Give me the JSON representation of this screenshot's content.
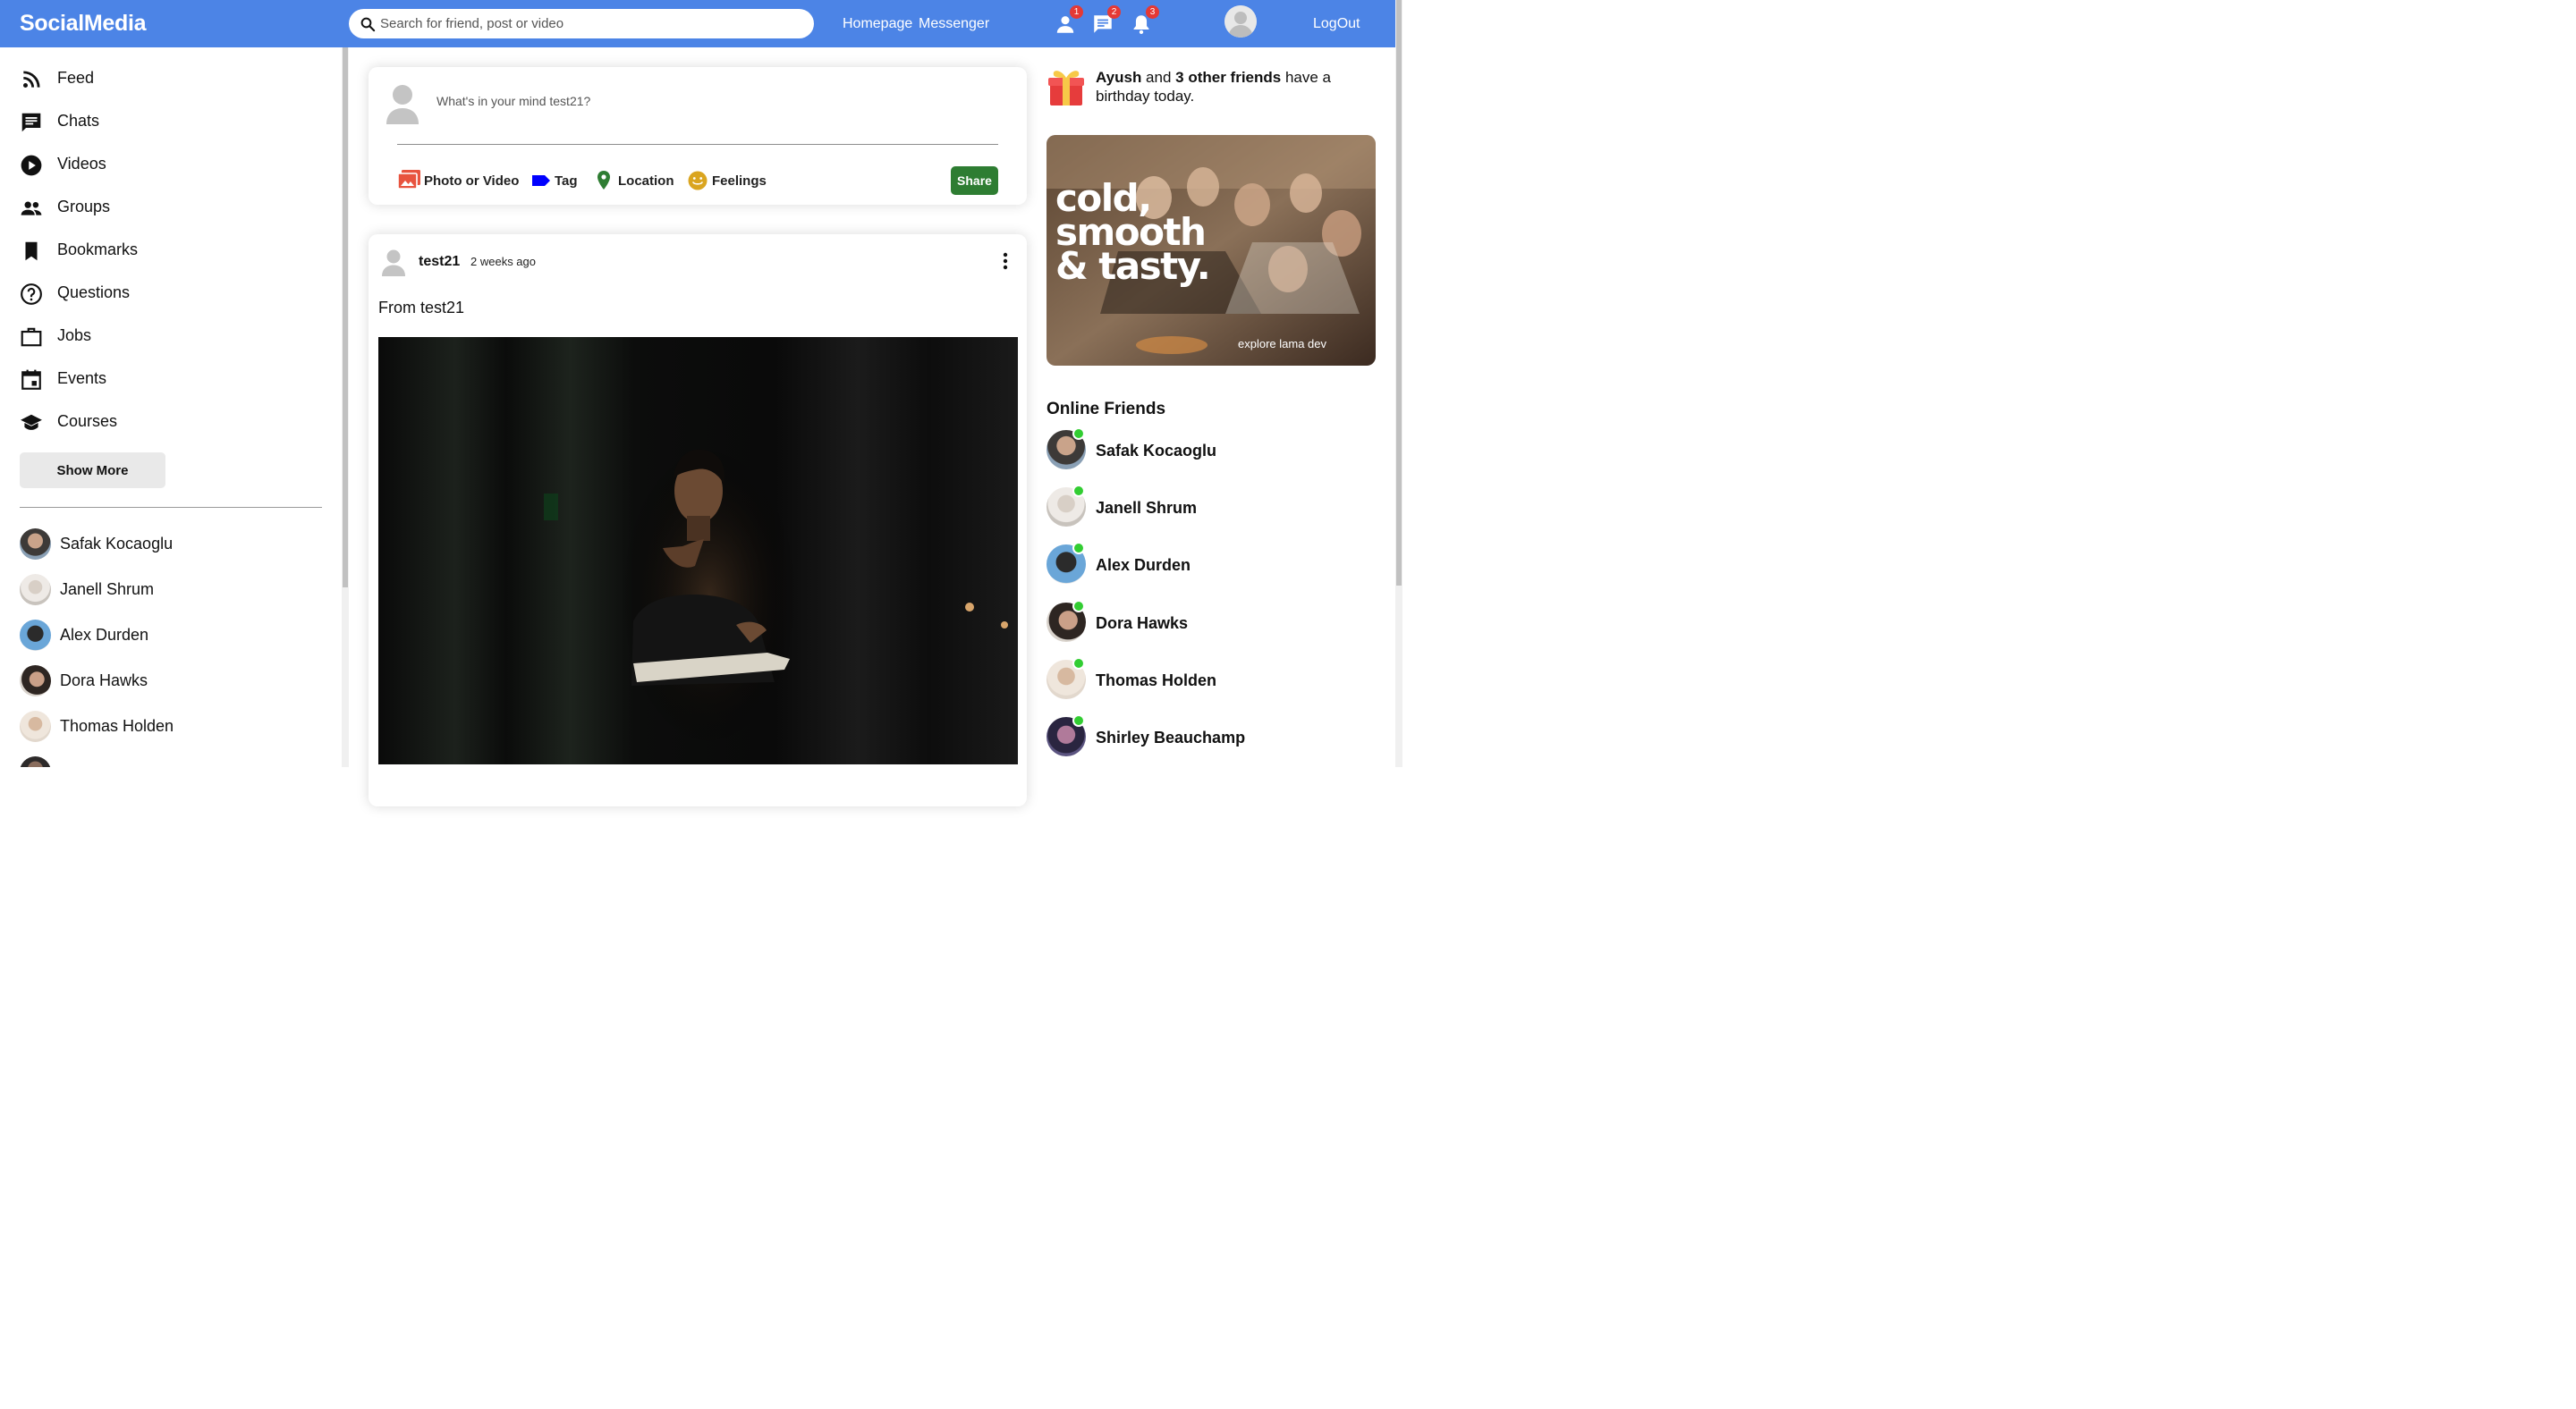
{
  "app": {
    "logo": "SocialMedia"
  },
  "topbar": {
    "search_placeholder": "Search for friend, post or video",
    "links": [
      "Homepage",
      "Messenger"
    ],
    "badges": {
      "friends": "1",
      "messages": "2",
      "notifications": "3"
    },
    "logout": "LogOut"
  },
  "sidebar": {
    "items": [
      {
        "label": "Feed",
        "icon": "rss-feed-icon"
      },
      {
        "label": "Chats",
        "icon": "chat-icon"
      },
      {
        "label": "Videos",
        "icon": "play-circle-icon"
      },
      {
        "label": "Groups",
        "icon": "group-icon"
      },
      {
        "label": "Bookmarks",
        "icon": "bookmark-icon"
      },
      {
        "label": "Questions",
        "icon": "help-circle-icon"
      },
      {
        "label": "Jobs",
        "icon": "work-icon"
      },
      {
        "label": "Events",
        "icon": "event-icon"
      },
      {
        "label": "Courses",
        "icon": "school-icon"
      }
    ],
    "show_more": "Show More",
    "friends": [
      "Safak Kocaoglu",
      "Janell Shrum",
      "Alex Durden",
      "Dora Hawks",
      "Thomas Holden"
    ]
  },
  "share": {
    "placeholder": "What's in your mind test21?",
    "options": [
      "Photo or Video",
      "Tag",
      "Location",
      "Feelings"
    ],
    "button": "Share",
    "colors": {
      "photo": "#e8543f",
      "tag": "#0000ff",
      "location": "#2e7d32",
      "feelings": "#daa520",
      "share": "#2e7d32"
    }
  },
  "post": {
    "username": "test21",
    "time": "2 weeks ago",
    "text": "From test21"
  },
  "rightbar": {
    "birthday": {
      "name": "Ayush",
      "connector": " and ",
      "others": "3 other friends",
      "rest": " have a birthday today."
    },
    "ad": {
      "headline_1": "cold,",
      "headline_2": "smooth",
      "headline_3": "& tasty.",
      "tagline": "explore lama dev"
    },
    "online_title": "Online Friends",
    "online_friends": [
      "Safak Kocaoglu",
      "Janell Shrum",
      "Alex Durden",
      "Dora Hawks",
      "Thomas Holden",
      "Shirley Beauchamp"
    ]
  },
  "colors": {
    "topbar": "#4c84e6",
    "online_dot": "#32cd32",
    "badge": "#e53935"
  }
}
